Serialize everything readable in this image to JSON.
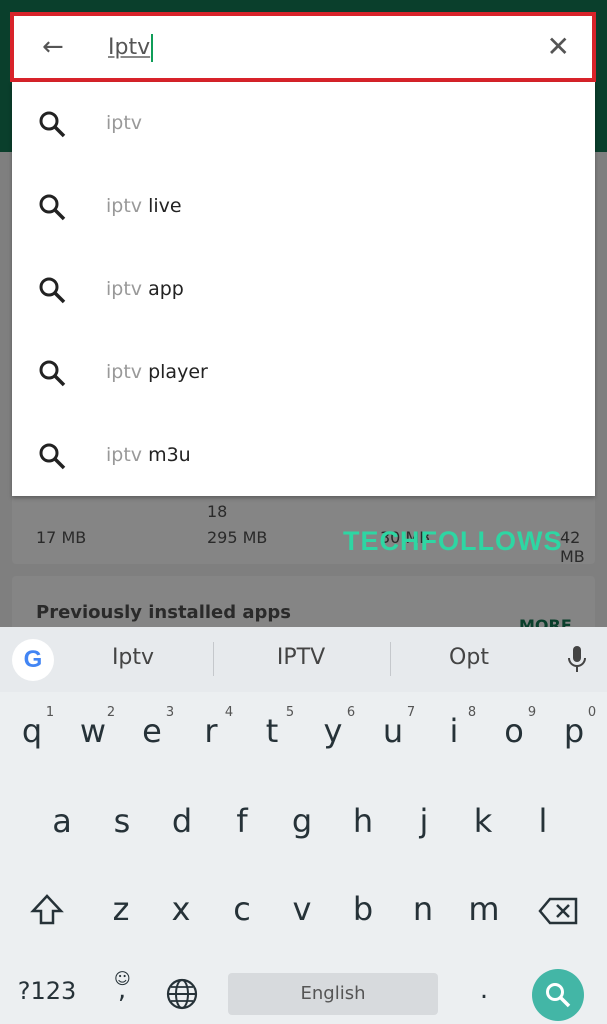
{
  "search": {
    "query": "Iptv",
    "back_icon": "arrow-back-icon",
    "clear_icon": "close-icon"
  },
  "suggestions": [
    {
      "prefix": "iptv",
      "rest": ""
    },
    {
      "prefix": "iptv",
      "rest": " live"
    },
    {
      "prefix": "iptv",
      "rest": " app"
    },
    {
      "prefix": "iptv",
      "rest": " player"
    },
    {
      "prefix": "iptv",
      "rest": " m3u"
    }
  ],
  "background": {
    "sizes": [
      "17 MB",
      "295 MB",
      "30 MB",
      "42 MB"
    ],
    "rating_fragment": "18",
    "section_title": "Previously installed apps",
    "more": "MORE"
  },
  "watermark": "TECHFOLLOWS",
  "keyboard": {
    "suggestions": [
      "Iptv",
      "IPTV",
      "Opt"
    ],
    "row1": [
      "q",
      "w",
      "e",
      "r",
      "t",
      "y",
      "u",
      "i",
      "o",
      "p"
    ],
    "row1_nums": [
      "1",
      "2",
      "3",
      "4",
      "5",
      "6",
      "7",
      "8",
      "9",
      "0"
    ],
    "row2": [
      "a",
      "s",
      "d",
      "f",
      "g",
      "h",
      "j",
      "k",
      "l"
    ],
    "row3": [
      "z",
      "x",
      "c",
      "v",
      "b",
      "n",
      "m"
    ],
    "symbols": "?123",
    "comma": ",",
    "period": ".",
    "space": "English"
  },
  "colors": {
    "accent": "#0f9d58",
    "highlight": "#d8232a",
    "header": "#0a3f2c",
    "watermark": "#2ed6a3",
    "search_key": "#43b6a6"
  }
}
